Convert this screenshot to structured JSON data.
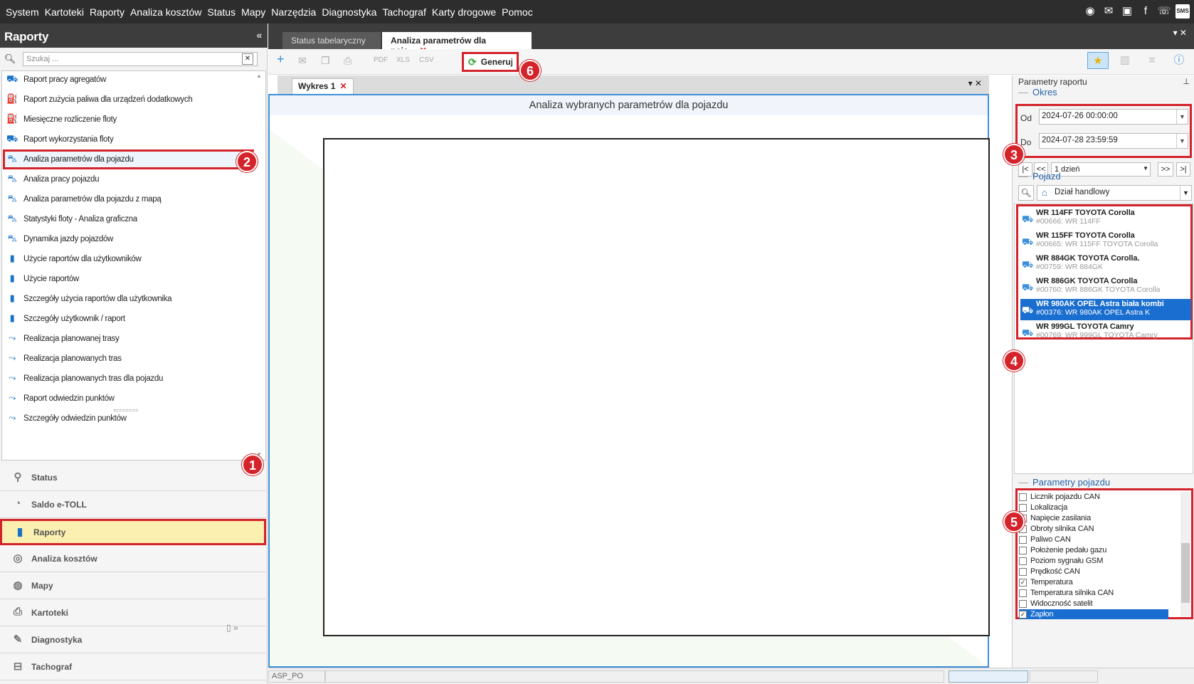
{
  "menu": [
    "System",
    "Kartoteki",
    "Raporty",
    "Analiza kosztów",
    "Status",
    "Mapy",
    "Narzędzia",
    "Diagnostyka",
    "Tachograf",
    "Karty drogowe",
    "Pomoc"
  ],
  "top_icons": [
    "help-circle-icon",
    "mail-warning-icon",
    "chat-icon",
    "facebook-icon",
    "phone-icon",
    "sms-icon"
  ],
  "sms_label": "SMS",
  "left": {
    "title": "Raporty",
    "search_placeholder": "Szukaj ...",
    "reports": [
      {
        "label": "Raport pracy agregatów",
        "icon": "truck-icon"
      },
      {
        "label": "Raport zużycia paliwa dla urządzeń dodatkowych",
        "icon": "fuel-icon"
      },
      {
        "label": "Miesięczne rozliczenie floty",
        "icon": "fuel-icon"
      },
      {
        "label": "Raport wykorzystania floty",
        "icon": "fleet-icon"
      },
      {
        "label": "Analiza parametrów dla pojazdu",
        "icon": "car-chart-icon"
      },
      {
        "label": "Analiza pracy pojazdu",
        "icon": "car-chart-icon"
      },
      {
        "label": "Analiza parametrów dla pojazdu z mapą",
        "icon": "car-chart-icon"
      },
      {
        "label": "Statystyki floty - Analiza graficzna",
        "icon": "car-chart-icon"
      },
      {
        "label": "Dynamika jazdy pojazdów",
        "icon": "car-chart-icon"
      },
      {
        "label": "Użycie raportów dla użytkowników",
        "icon": "bar-chart-icon"
      },
      {
        "label": "Użycie raportów",
        "icon": "bar-chart-icon"
      },
      {
        "label": "Szczegóły użycia raportów dla użytkownika",
        "icon": "bar-chart-icon"
      },
      {
        "label": "Szczegóły użytkownik / raport",
        "icon": "bar-chart-icon"
      },
      {
        "label": "Realizacja planowanej trasy",
        "icon": "route-icon"
      },
      {
        "label": "Realizacja planowanych tras",
        "icon": "route-icon"
      },
      {
        "label": "Realizacja planowanych tras dla pojazdu",
        "icon": "route-icon"
      },
      {
        "label": "Raport odwiedzin punktów",
        "icon": "route-icon"
      },
      {
        "label": "Szczegóły odwiedzin punktów",
        "icon": "route-icon"
      }
    ],
    "nav": [
      {
        "label": "Status",
        "icon": "location-pin-icon"
      },
      {
        "label": "Saldo e-TOLL",
        "icon": "toll-icon"
      },
      {
        "label": "Raporty",
        "icon": "bar-chart-icon"
      },
      {
        "label": "Analiza kosztów",
        "icon": "coins-icon"
      },
      {
        "label": "Mapy",
        "icon": "globe-icon"
      },
      {
        "label": "Kartoteki",
        "icon": "printer-icon"
      },
      {
        "label": "Diagnostyka",
        "icon": "wrench-icon"
      },
      {
        "label": "Tachograf",
        "icon": "tachograph-icon"
      }
    ]
  },
  "tabs": {
    "tab1": "Status tabelaryczny",
    "tab2": "Analiza parametrów dla poja..."
  },
  "toolbar": {
    "pdf": "PDF",
    "xls": "XLS",
    "csv": "CSV",
    "generate": "Generuj"
  },
  "chart": {
    "tab": "Wykres 1",
    "title": "Analiza wybranych parametrów dla pojazdu"
  },
  "status": {
    "user": "ASP_PO"
  },
  "right": {
    "title": "Parametry raportu",
    "okres": "Okres",
    "od_label": "Od",
    "do_label": "Do",
    "od_value": "2024-07-26  00:00:00",
    "do_value": "2024-07-28  23:59:59",
    "period": "1 dzień",
    "pojazd": "Pojazd",
    "group": "Dział handlowy",
    "vehicles": [
      {
        "name": "WR 114FF TOYOTA Corolla",
        "sub": "#00666: WR 114FF"
      },
      {
        "name": "WR 115FF TOYOTA Corolla",
        "sub": "#00665: WR 115FF TOYOTA Corolla"
      },
      {
        "name": "WR 884GK TOYOTA Corolla.",
        "sub": "#00759: WR 884GK"
      },
      {
        "name": "WR 886GK TOYOTA Corolla",
        "sub": "#00760: WR 886GK TOYOTA Corolla"
      },
      {
        "name": "WR 980AK OPEL Astra biała kombi",
        "sub": "#00376: WR 980AK OPEL Astra K"
      },
      {
        "name": "WR 999GL TOYOTA Camry",
        "sub": "#00769: WR 999GL TOYOTA Camry"
      }
    ],
    "selected_vehicle": 4,
    "params_title": "Parametry pojazdu",
    "params": [
      {
        "label": "Licznik pojazdu CAN",
        "checked": false
      },
      {
        "label": "Lokalizacja",
        "checked": false
      },
      {
        "label": "Napięcie zasilania",
        "checked": false
      },
      {
        "label": "Obroty silnika CAN",
        "checked": false
      },
      {
        "label": "Paliwo CAN",
        "checked": false
      },
      {
        "label": "Położenie pedału gazu",
        "checked": false
      },
      {
        "label": "Poziom sygnału GSM",
        "checked": false
      },
      {
        "label": "Prędkość CAN",
        "checked": false
      },
      {
        "label": "Temperatura",
        "checked": true
      },
      {
        "label": "Temperatura silnika CAN",
        "checked": false
      },
      {
        "label": "Widoczność satelit",
        "checked": false
      },
      {
        "label": "Zapłon",
        "checked": true
      }
    ]
  },
  "badges": [
    "1",
    "2",
    "3",
    "4",
    "5",
    "6"
  ]
}
